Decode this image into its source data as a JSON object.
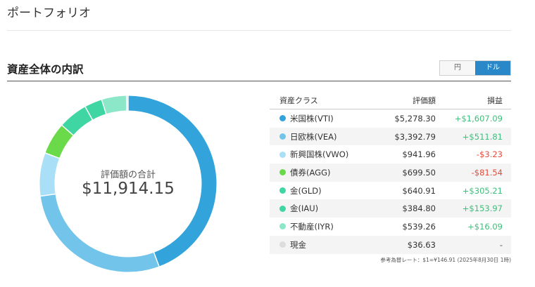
{
  "header": {
    "title": "ポートフォリオ"
  },
  "section": {
    "title": "資産全体の内訳"
  },
  "currency_toggle": {
    "yen_label": "円",
    "dollar_label": "ドル",
    "selected": "ドル"
  },
  "total": {
    "label": "評価額の合計",
    "value": "$11,914.15"
  },
  "table": {
    "headers": {
      "asset_class": "資産クラス",
      "valuation": "評価額",
      "pnl": "損益"
    },
    "rows": [
      {
        "name": "米国株(VTI)",
        "value": "$5,278.30",
        "amount": 5278.3,
        "pnl": "+$1,607.09",
        "sign": "pos",
        "color": "#33a3dc"
      },
      {
        "name": "日欧株(VEA)",
        "value": "$3,392.79",
        "amount": 3392.79,
        "pnl": "+$511.81",
        "sign": "pos",
        "color": "#72c4ea"
      },
      {
        "name": "新興国株(VWO)",
        "value": "$941.96",
        "amount": 941.96,
        "pnl": "-$3.23",
        "sign": "neg",
        "color": "#a9e0f7"
      },
      {
        "name": "債券(AGG)",
        "value": "$699.50",
        "amount": 699.5,
        "pnl": "-$81.54",
        "sign": "neg",
        "color": "#6ad94a"
      },
      {
        "name": "金(GLD)",
        "value": "$640.91",
        "amount": 640.91,
        "pnl": "+$305.21",
        "sign": "pos",
        "color": "#3fd6a4"
      },
      {
        "name": "金(IAU)",
        "value": "$384.80",
        "amount": 384.8,
        "pnl": "+$153.97",
        "sign": "pos",
        "color": "#3fd6a4"
      },
      {
        "name": "不動産(IYR)",
        "value": "$539.26",
        "amount": 539.26,
        "pnl": "+$16.09",
        "sign": "pos",
        "color": "#8ce6c8"
      },
      {
        "name": "現金",
        "value": "$36.63",
        "amount": 36.63,
        "pnl": "-",
        "sign": "neu",
        "color": "#dddddd"
      }
    ]
  },
  "footnote": "参考為替レート：$1=¥146.91 (2025年8月30日 1時)"
}
